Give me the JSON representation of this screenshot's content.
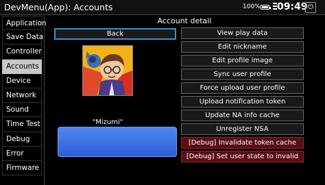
{
  "header": {
    "title": "DevMenu(App): Accounts",
    "battery": "100%",
    "clock": "09:49",
    "power_glyph": "⏻"
  },
  "sidebar": {
    "items": [
      {
        "label": "Application"
      },
      {
        "label": "Save Data"
      },
      {
        "label": "Controller"
      },
      {
        "label": "Accounts",
        "active": true
      },
      {
        "label": "Device"
      },
      {
        "label": "Network"
      },
      {
        "label": "Sound"
      },
      {
        "label": "Time Test"
      },
      {
        "label": "Debug"
      },
      {
        "label": "Error"
      },
      {
        "label": "Firmware"
      }
    ]
  },
  "main": {
    "title": "Account detail",
    "back_label": "Back",
    "nickname": "\"Mizumi\"",
    "actions": [
      {
        "label": "View play data"
      },
      {
        "label": "Edit nickname"
      },
      {
        "label": "Edit profile image"
      },
      {
        "label": "Sync user profile"
      },
      {
        "label": "Force upload user profile"
      },
      {
        "label": "Upload notification token"
      },
      {
        "label": "Update NA info cache"
      },
      {
        "label": "Unregister NSA"
      },
      {
        "label": "[Debug] Invalidate token cache",
        "debug": true
      },
      {
        "label": "[Debug] Set user state to invalid",
        "debug": true
      }
    ]
  },
  "colors": {
    "selection_border": "#3c8fd6",
    "debug_button": "#5a0d12",
    "name_box": "#3a6fe6",
    "active_tab": "#c8c8c8"
  }
}
